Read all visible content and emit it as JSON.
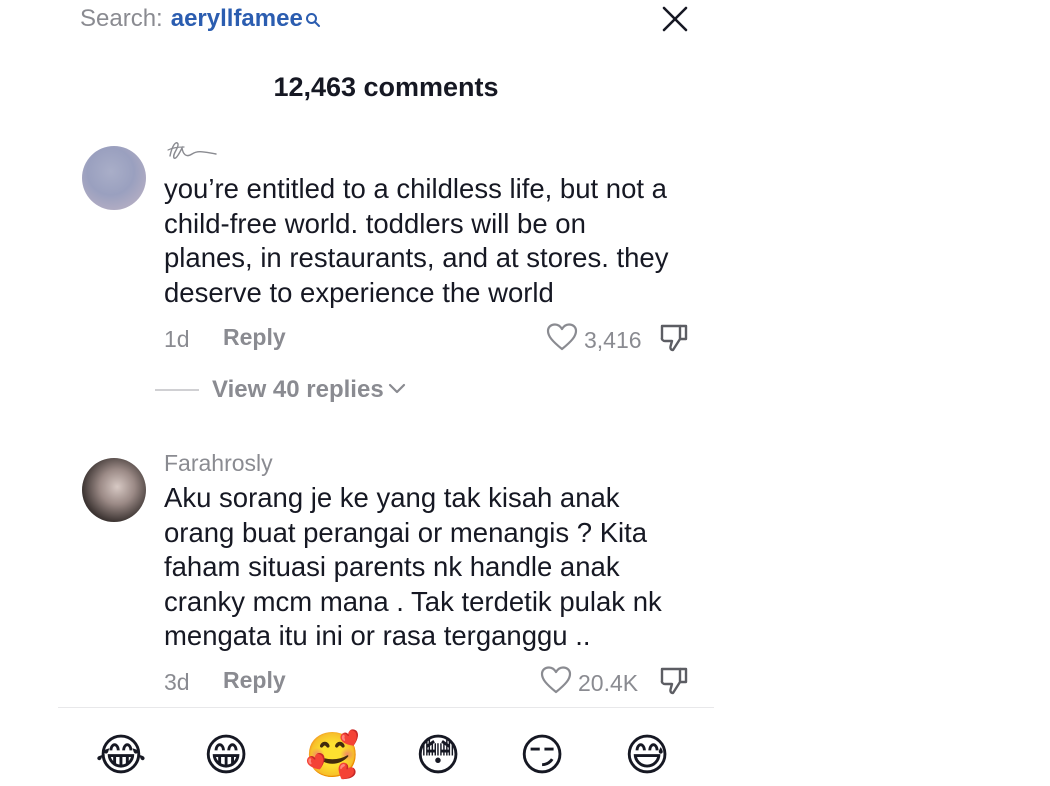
{
  "search": {
    "prefix": "Search:",
    "query": "aeryllfamee"
  },
  "header": {
    "comment_count": "12,463 comments"
  },
  "comments": [
    {
      "username": "",
      "avatar": "avatar-image",
      "text": "you’re entitled to a childless life, but not a\nchild-free world. toddlers will be on\nplanes, in restaurants, and at stores. they\ndeserve to experience the world",
      "time": "1d",
      "reply_label": "Reply",
      "likes": "3,416"
    },
    {
      "username": "Farahrosly",
      "avatar": "avatar-image",
      "text": "Aku sorang je ke yang tak kisah anak\norang buat perangai or menangis ? Kita\nfaham situasi parents nk handle anak\ncranky mcm mana . Tak terdetik pulak nk\nmengata itu ini or rasa terganggu ..",
      "time": "3d",
      "reply_label": "Reply",
      "likes": "20.4K"
    }
  ],
  "view_replies": {
    "label": "View 40 replies"
  },
  "emoji_bar": [
    "😂",
    "😁",
    "🥰",
    "😳",
    "😏",
    "😅"
  ],
  "colors": {
    "text": "#161823",
    "muted": "#8a8b91",
    "link": "#2b5db0",
    "background": "#ffffff"
  },
  "icons": [
    "search-icon",
    "close-icon",
    "heart-icon",
    "dislike-icon",
    "chevron-down-icon"
  ]
}
